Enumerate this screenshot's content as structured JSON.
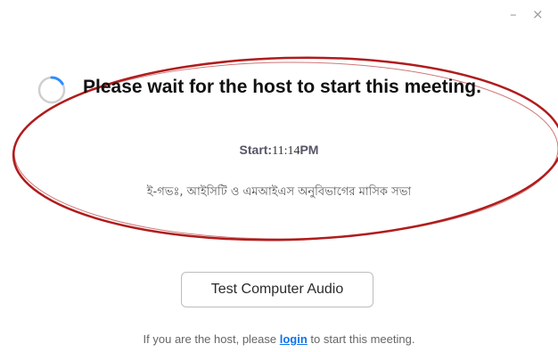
{
  "window": {
    "minimize_label": "–",
    "close_label": "×"
  },
  "main": {
    "title": "Please wait for the host to start this meeting.",
    "start_label": "Start:",
    "start_time_number": "11:14",
    "start_time_ampm": "PM",
    "meeting_topic": "ই-গভঃ, আইসিটি ও এমআইএস অনুবিভাগের মাসিক সভা",
    "test_audio_button": "Test Computer Audio",
    "host_prefix": "If you are the host, please ",
    "login_link": "login",
    "host_suffix": " to start this meeting."
  },
  "icons": {
    "spinner": "loading-spinner-icon",
    "minimize": "minimize-icon",
    "close": "close-icon"
  },
  "colors": {
    "annotation": "#b01c1c",
    "spinner_arc": "#2d8cff",
    "link": "#0e72ed"
  }
}
